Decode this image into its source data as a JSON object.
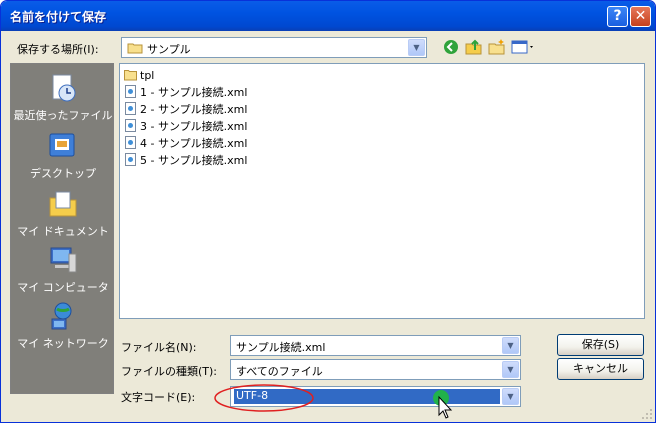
{
  "window": {
    "title": "名前を付けて保存",
    "help": "?",
    "close": "✕"
  },
  "location": {
    "label": "保存する場所(I):",
    "value": "サンプル"
  },
  "places": [
    {
      "label": "最近使ったファイル",
      "icon": "recent-documents-icon"
    },
    {
      "label": "デスクトップ",
      "icon": "desktop-icon"
    },
    {
      "label": "マイ ドキュメント",
      "icon": "my-documents-icon"
    },
    {
      "label": "マイ コンピュータ",
      "icon": "my-computer-icon"
    },
    {
      "label": "マイ ネットワーク",
      "icon": "my-network-icon"
    }
  ],
  "files": [
    {
      "name": "tpl",
      "type": "folder"
    },
    {
      "name": "1 - サンプル接続.xml",
      "type": "xml"
    },
    {
      "name": "2 - サンプル接続.xml",
      "type": "xml"
    },
    {
      "name": "3 - サンプル接続.xml",
      "type": "xml"
    },
    {
      "name": "4 - サンプル接続.xml",
      "type": "xml"
    },
    {
      "name": "5 - サンプル接続.xml",
      "type": "xml"
    }
  ],
  "form": {
    "filename_label": "ファイル名(N):",
    "filename_value": "サンプル接続.xml",
    "filetype_label": "ファイルの種類(T):",
    "filetype_value": "すべてのファイル",
    "encoding_label": "文字コード(E):",
    "encoding_value": "UTF-8"
  },
  "buttons": {
    "save": "保存(S)",
    "cancel": "キャンセル"
  },
  "colors": {
    "titlebar": "#0054e3",
    "highlight": "#316ac5",
    "annotation_circle": "#e02020",
    "cursor_dot": "#21b24a"
  }
}
